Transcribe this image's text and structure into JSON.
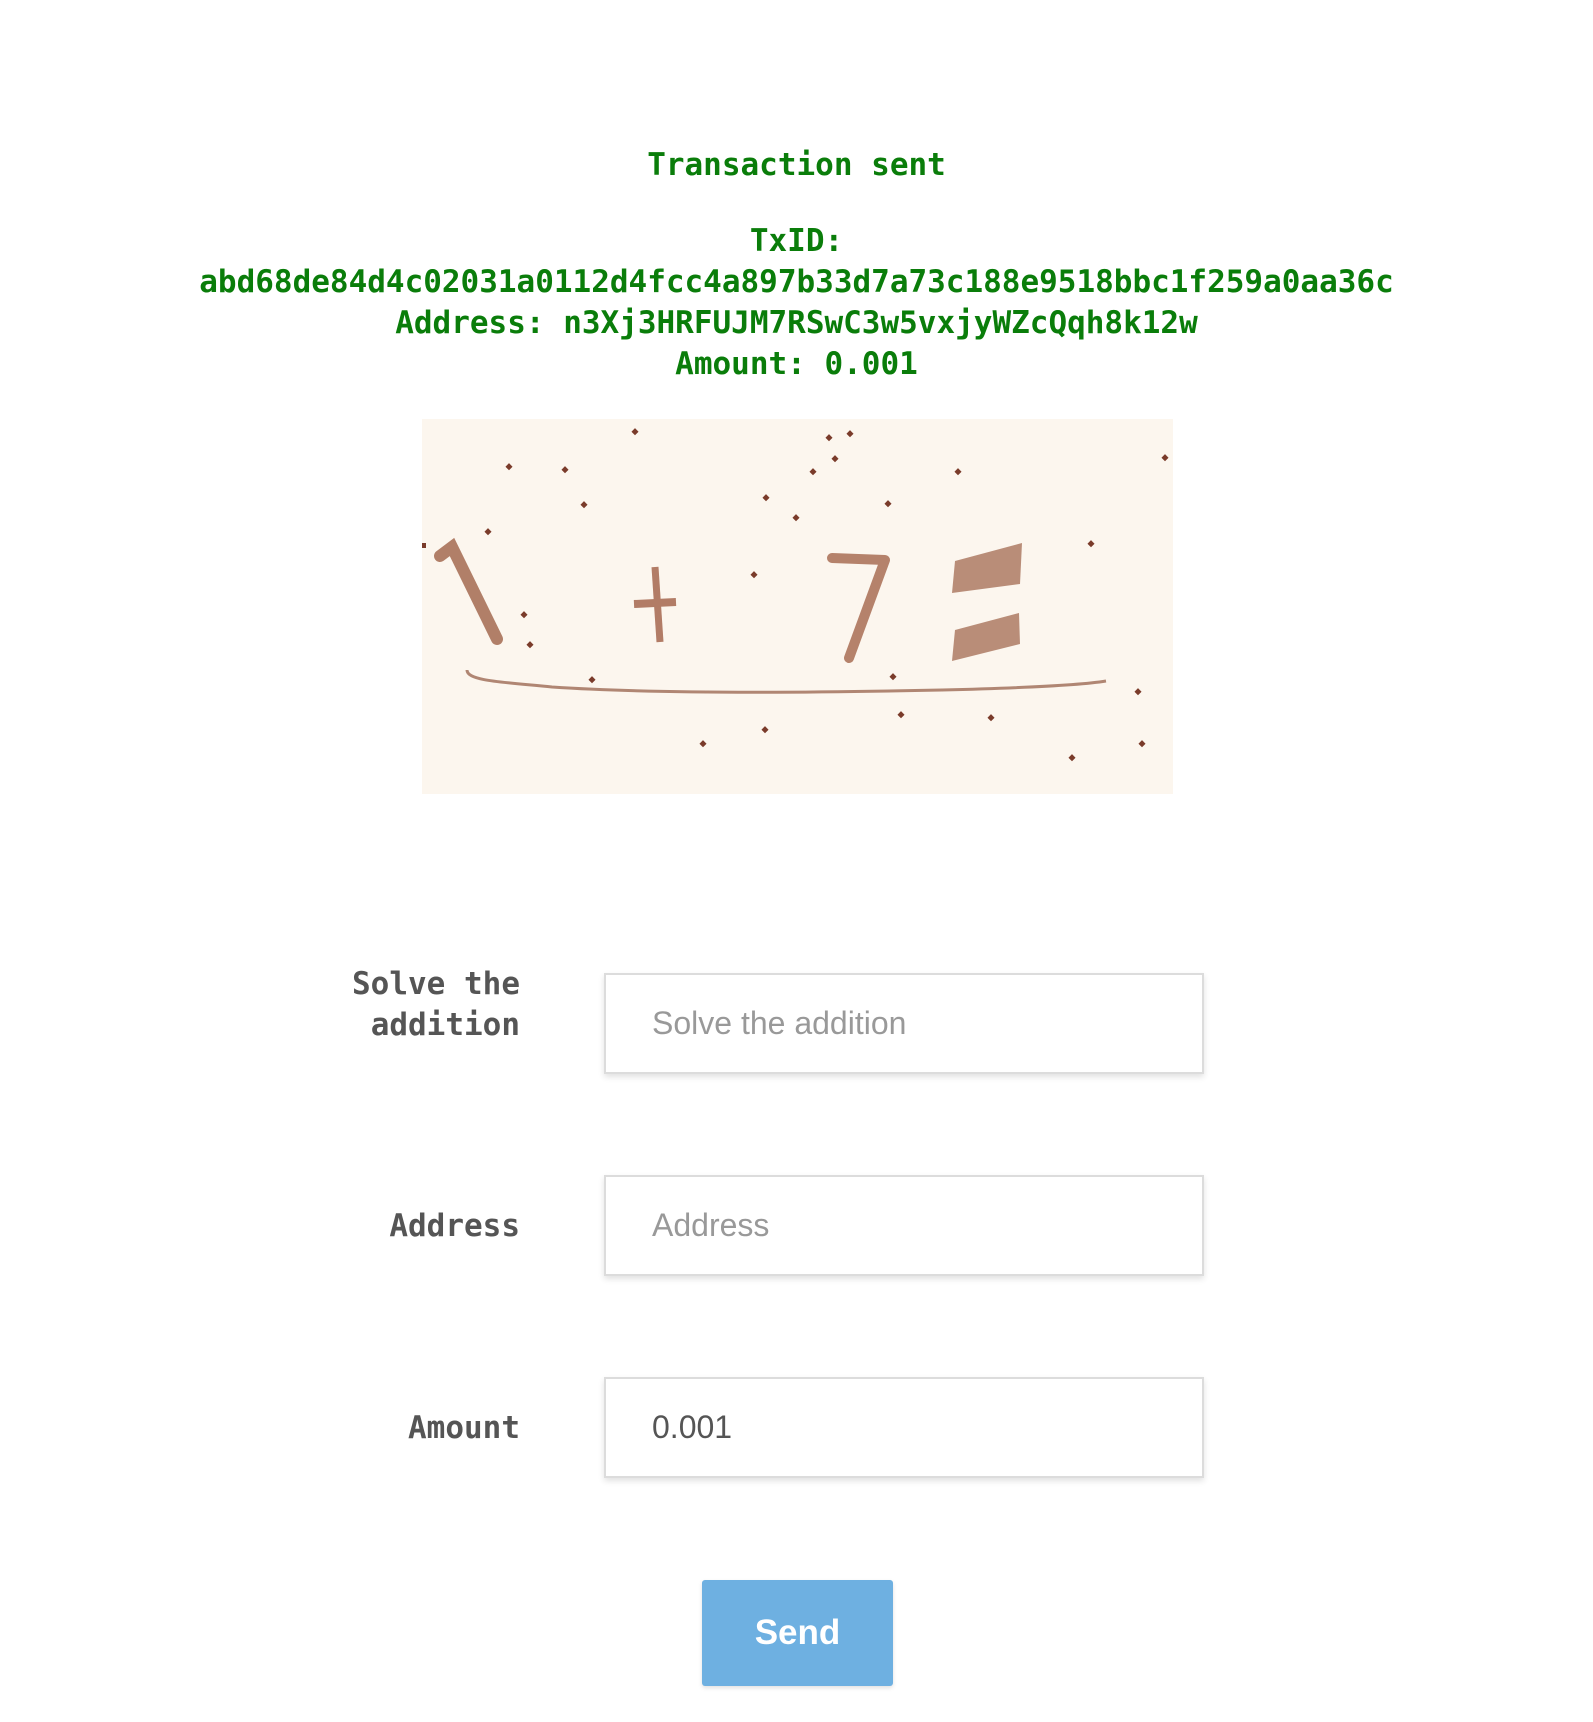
{
  "status": {
    "title": "Transaction sent",
    "txid_label": "TxID:",
    "txid": "abd68de84d4c02031a0112d4fcc4a897b33d7a73c188e9518bbc1f259a0aa36c",
    "address_line": "Address: n3Xj3HRFUJM7RSwC3w5vxjyWZcQqh8k12w",
    "amount_line": "Amount: 0.001",
    "color": "#0a7d0a"
  },
  "captcha": {
    "image_name": "captcha-image"
  },
  "form": {
    "captcha_label": "Solve the addition",
    "captcha_placeholder": "Solve the addition",
    "captcha_value": "",
    "address_label": "Address",
    "address_placeholder": "Address",
    "address_value": "",
    "amount_label": "Amount",
    "amount_placeholder": "Amount",
    "amount_value": "0.001",
    "send_label": "Send",
    "send_color": "#6eb0e1"
  }
}
